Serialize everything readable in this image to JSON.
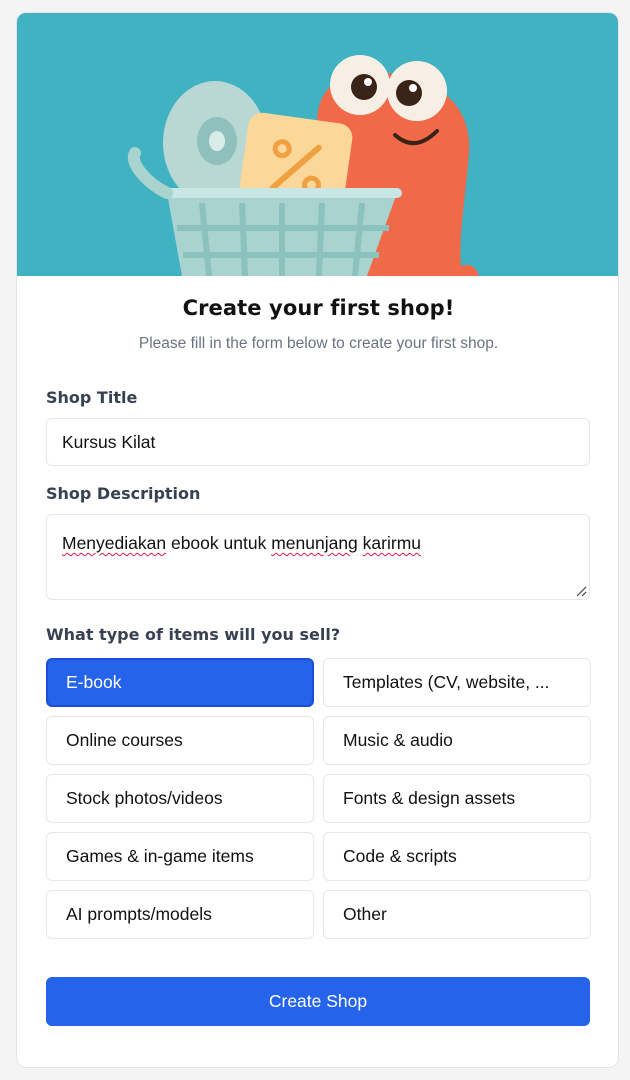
{
  "header": {
    "title": "Create your first shop!",
    "subtitle": "Please fill in the form below to create your first shop."
  },
  "form": {
    "shop_title": {
      "label": "Shop Title",
      "value": "Kursus Kilat"
    },
    "shop_description": {
      "label": "Shop Description",
      "value_parts": [
        "Menyediakan",
        " ebook untuk ",
        "menunjang",
        " ",
        "karirmu"
      ]
    },
    "item_types": {
      "label": "What type of items will you sell?",
      "options": [
        {
          "label": "E-book",
          "selected": true
        },
        {
          "label": "Templates (CV, website, ...",
          "selected": false
        },
        {
          "label": "Online courses",
          "selected": false
        },
        {
          "label": "Music & audio",
          "selected": false
        },
        {
          "label": "Stock photos/videos",
          "selected": false
        },
        {
          "label": "Fonts & design assets",
          "selected": false
        },
        {
          "label": "Games & in-game items",
          "selected": false
        },
        {
          "label": "Code & scripts",
          "selected": false
        },
        {
          "label": "AI prompts/models",
          "selected": false
        },
        {
          "label": "Other",
          "selected": false
        }
      ]
    },
    "submit_label": "Create Shop"
  },
  "colors": {
    "hero_background": "#40b2c1",
    "primary": "#2563eb",
    "mascot": "#f06a4a"
  },
  "icons": {
    "hero_illustration": "shopping-cart-mascot-illustration"
  }
}
